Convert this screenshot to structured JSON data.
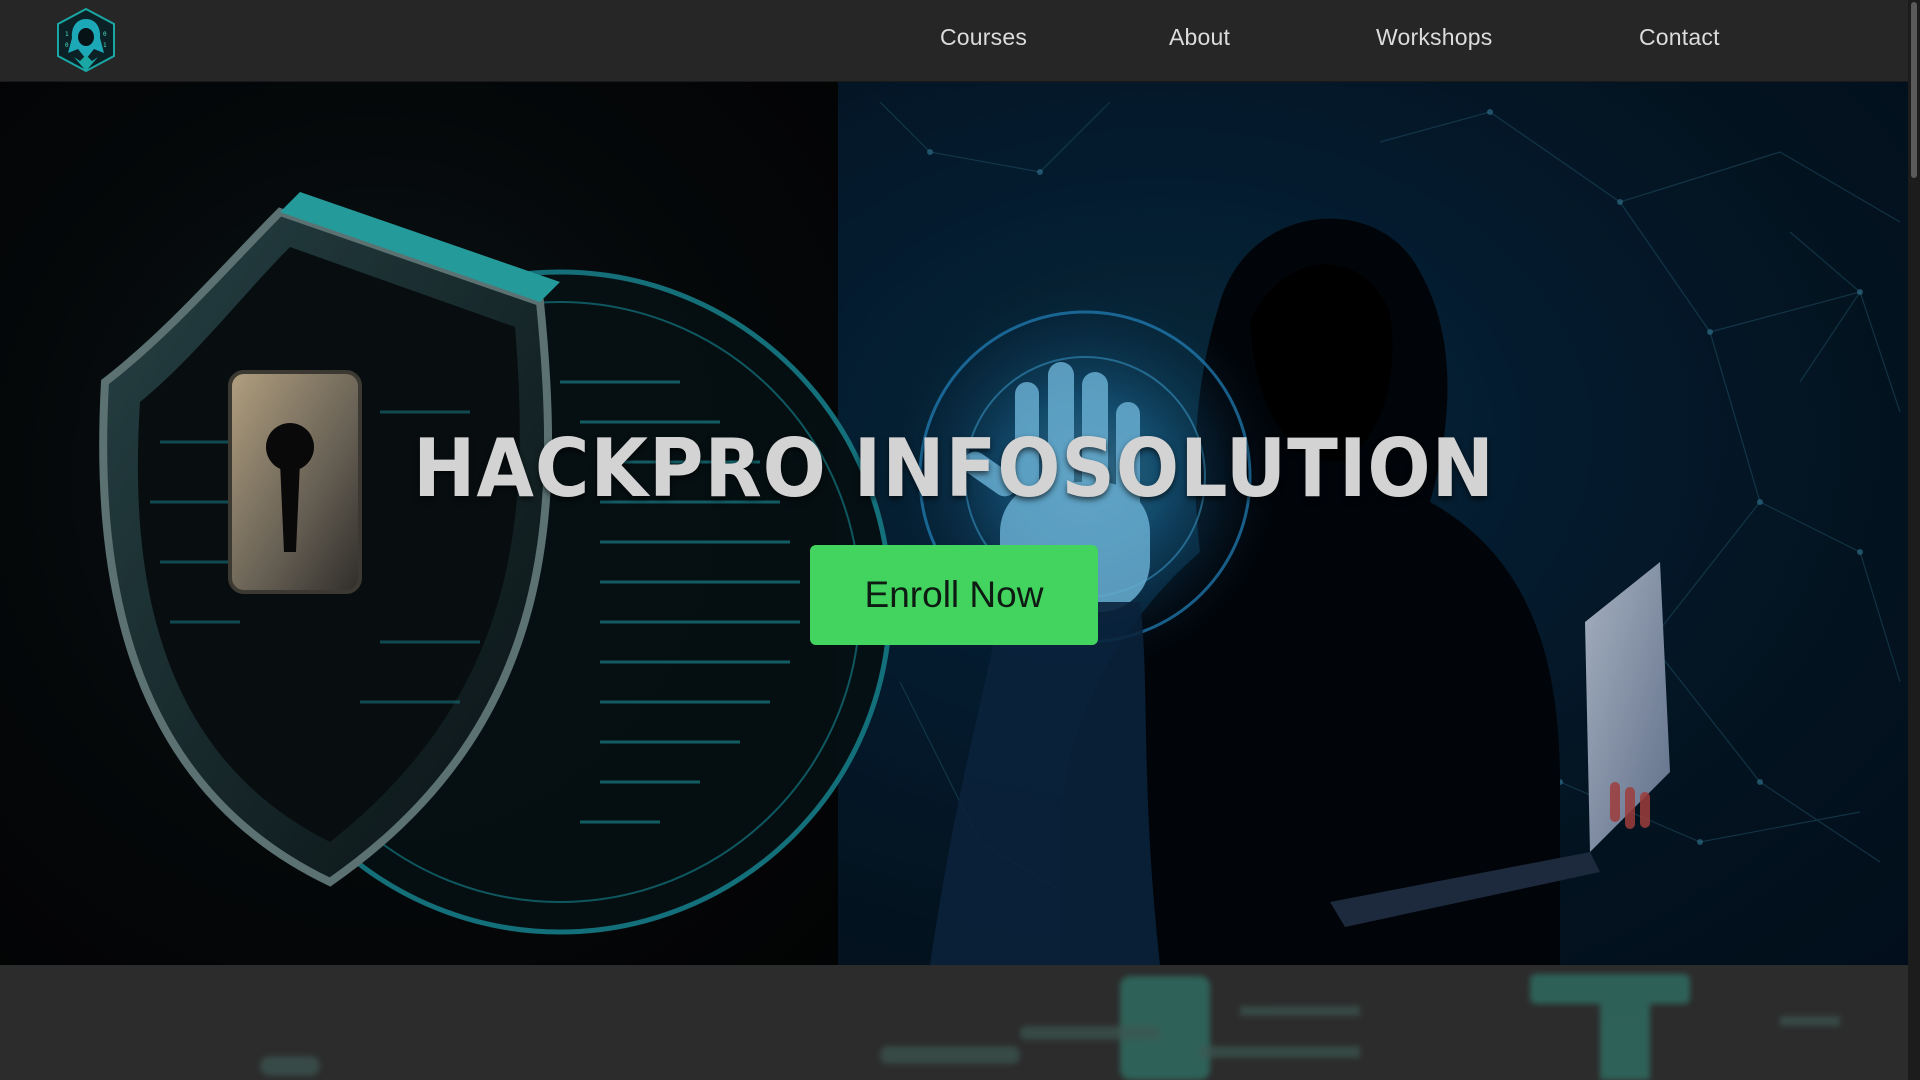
{
  "nav": {
    "logo_icon": "hooded-hacker-logo-icon",
    "links": [
      {
        "label": "Courses"
      },
      {
        "label": "About"
      },
      {
        "label": "Workshops"
      },
      {
        "label": "Contact"
      }
    ]
  },
  "hero": {
    "title": "HACKPRO INFOSOLUTION",
    "enroll_label": "Enroll Now",
    "left_image_icon": "shield-lock-icon",
    "right_image_icon": "hooded-hacker-hand-icon"
  },
  "colors": {
    "accent_green": "#43d35f",
    "nav_bg": "#262626",
    "title_text": "#d3d3d3",
    "cyan": "#1aa7a4"
  }
}
